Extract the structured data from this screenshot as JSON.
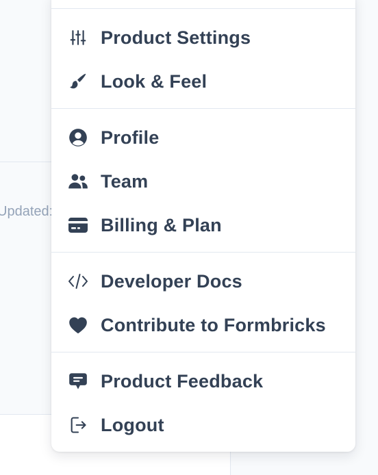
{
  "background": {
    "updated_text": "Updated:"
  },
  "menu": {
    "groups": [
      [
        {
          "label": "Product Settings",
          "icon": "sliders-icon"
        },
        {
          "label": "Look & Feel",
          "icon": "paintbrush-icon"
        }
      ],
      [
        {
          "label": "Profile",
          "icon": "user-circle-icon"
        },
        {
          "label": "Team",
          "icon": "users-icon"
        },
        {
          "label": "Billing & Plan",
          "icon": "credit-card-icon"
        }
      ],
      [
        {
          "label": "Developer Docs",
          "icon": "code-icon"
        },
        {
          "label": "Contribute to Formbricks",
          "icon": "heart-icon"
        }
      ],
      [
        {
          "label": "Product Feedback",
          "icon": "chat-bubble-icon"
        },
        {
          "label": "Logout",
          "icon": "logout-icon"
        }
      ]
    ]
  },
  "colors": {
    "text": "#334155",
    "icon": "#334155",
    "divider": "#e2e8f0",
    "background": "#f8fafc",
    "muted": "#94a3b8"
  }
}
